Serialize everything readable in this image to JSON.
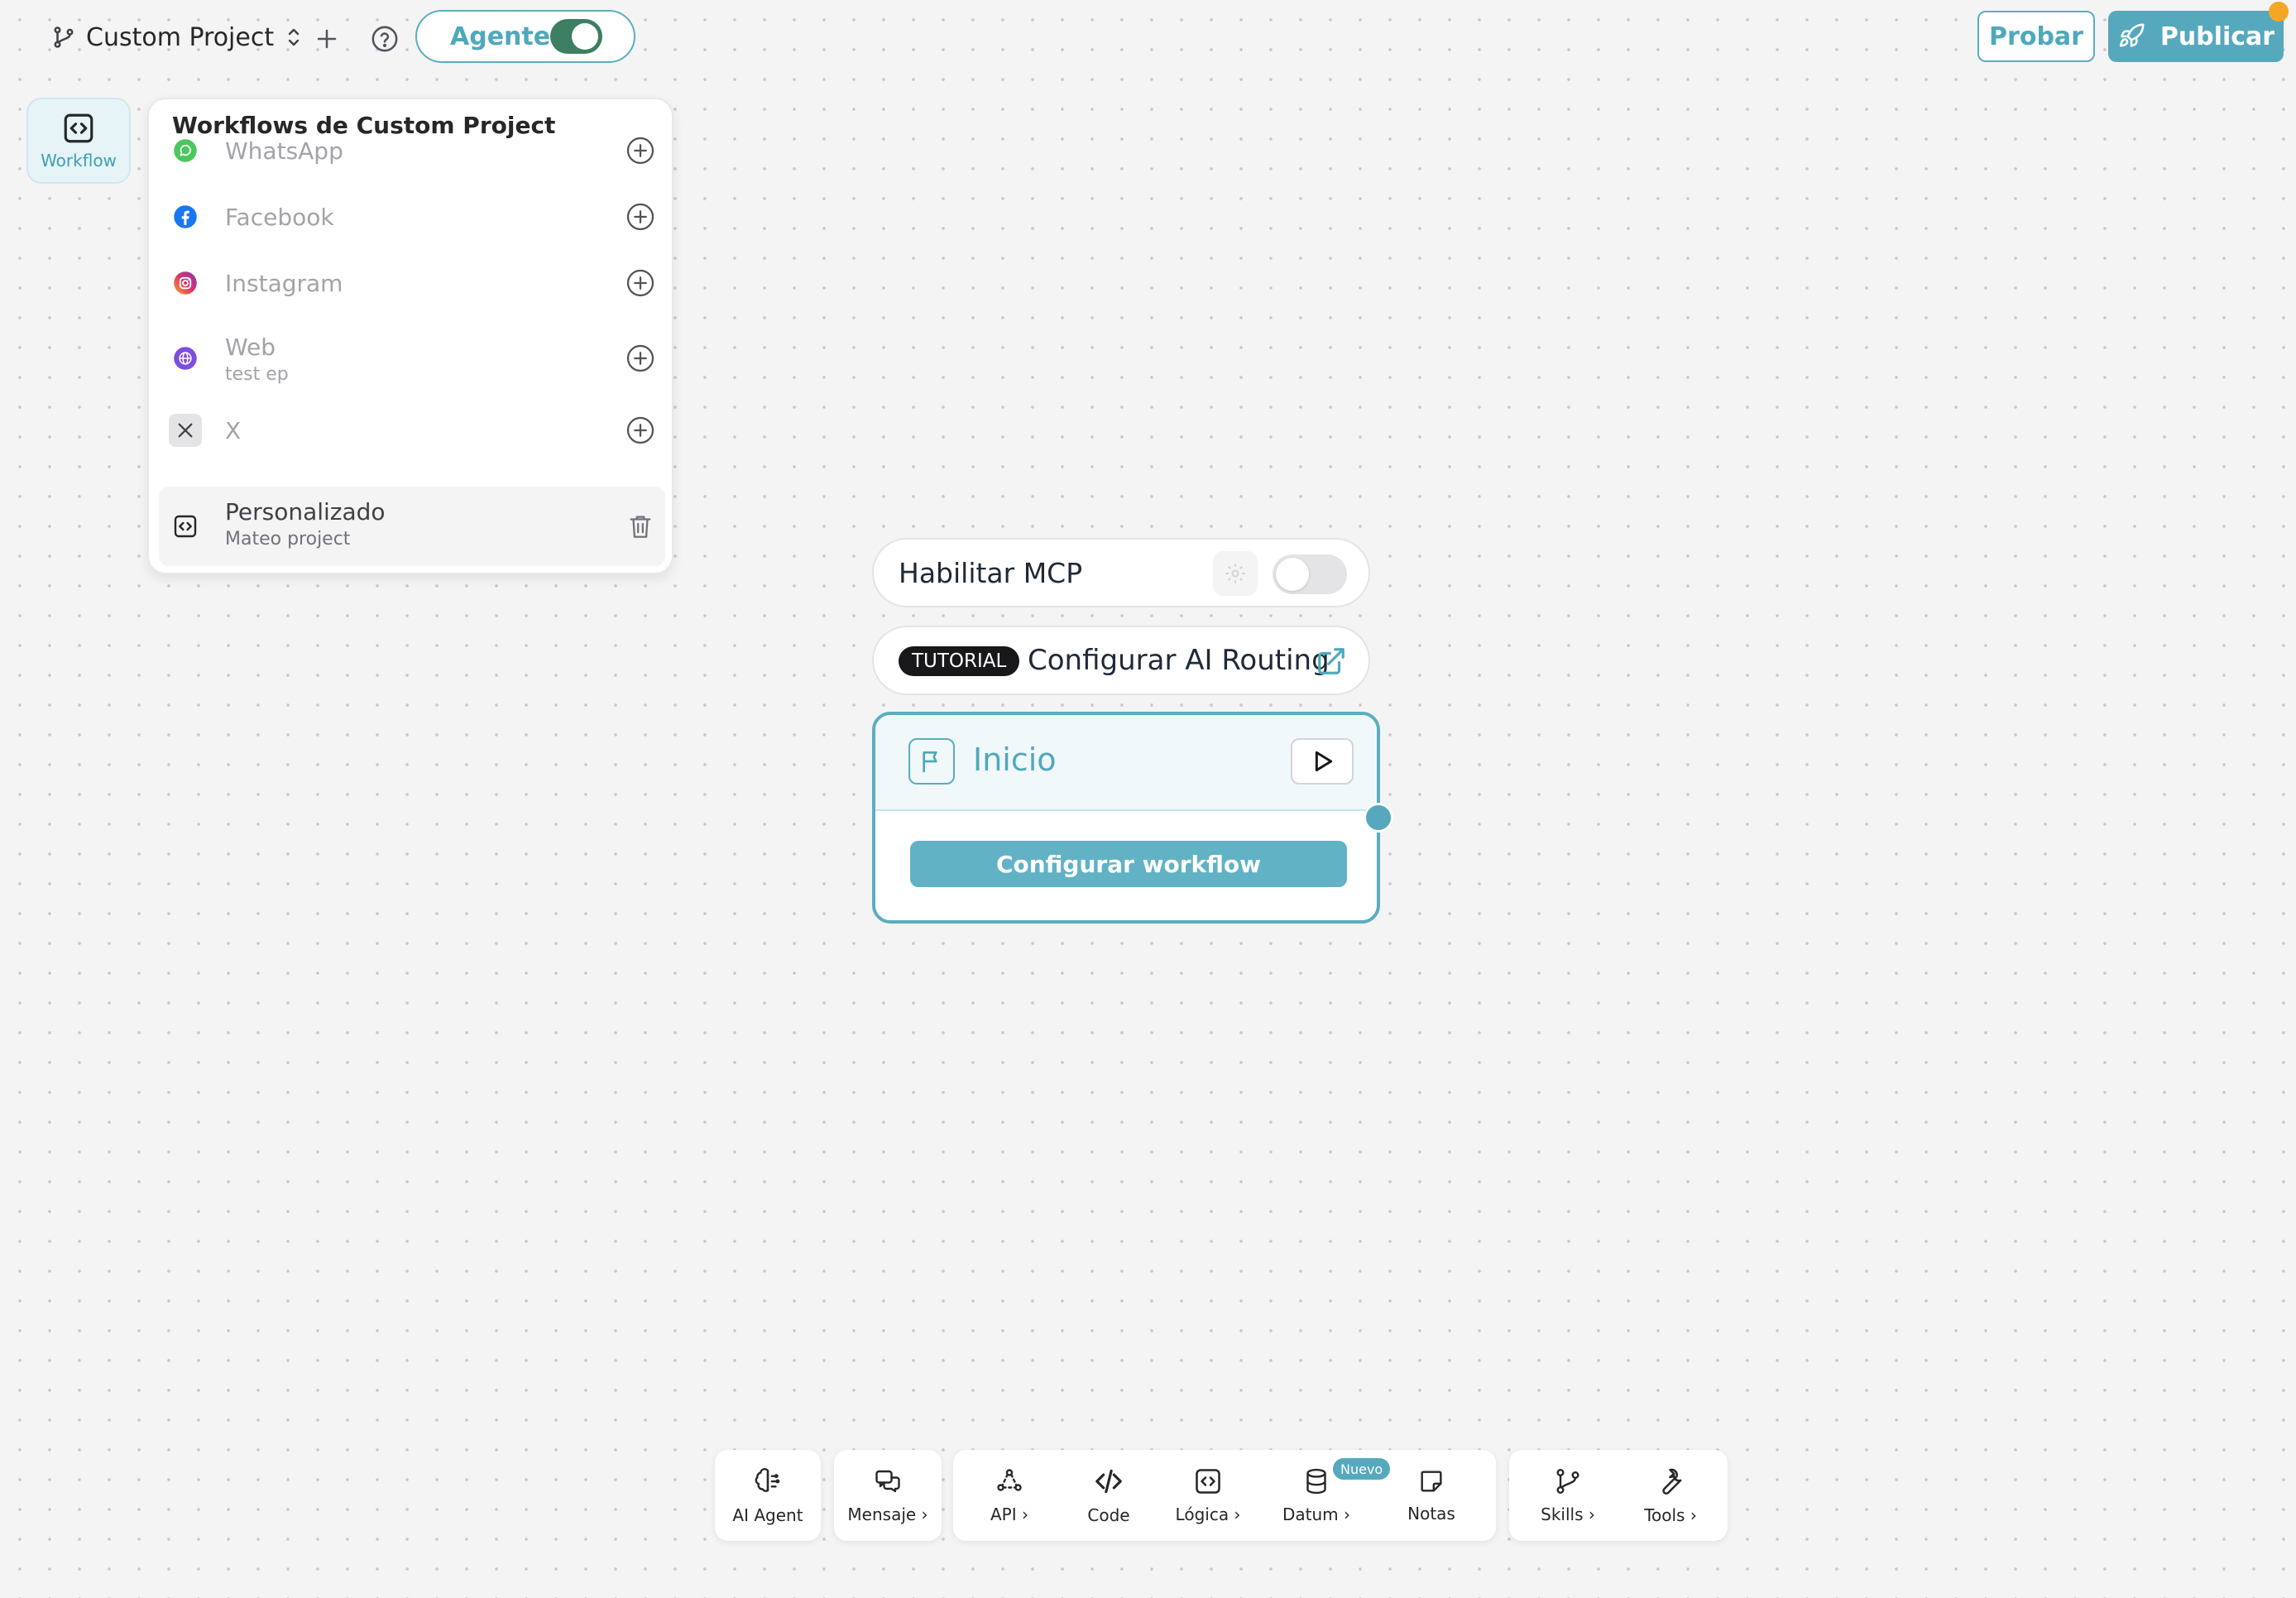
{
  "topbar": {
    "project_name": "Custom Project",
    "agent_label": "Agente",
    "agent_enabled": true,
    "probar_label": "Probar",
    "publicar_label": "Publicar"
  },
  "sidebar": {
    "workflow_label": "Workflow"
  },
  "workflows_panel": {
    "title": "Workflows de Custom Project",
    "items": [
      {
        "name": "WhatsApp",
        "subtitle": "",
        "icon": "whatsapp-icon"
      },
      {
        "name": "Facebook",
        "subtitle": "",
        "icon": "facebook-icon"
      },
      {
        "name": "Instagram",
        "subtitle": "",
        "icon": "instagram-icon"
      },
      {
        "name": "Web",
        "subtitle": "test ep",
        "icon": "web-globe-icon"
      },
      {
        "name": "X",
        "subtitle": "",
        "icon": "x-icon"
      },
      {
        "name": "Personalizado",
        "subtitle": "Mateo project",
        "icon": "code-icon",
        "selected": true
      }
    ]
  },
  "canvas": {
    "mcp_label": "Habilitar MCP",
    "mcp_enabled": false,
    "tutorial_badge": "TUTORIAL",
    "tutorial_label": "Configurar AI Routing",
    "start_node": {
      "title": "Inicio",
      "configure_button": "Configurar workflow"
    }
  },
  "toolbar": {
    "ai_agent": "AI Agent",
    "mensaje": "Mensaje ›",
    "api": "API ›",
    "code": "Code",
    "logica": "Lógica ›",
    "datum": "Datum ›",
    "nuevo_badge": "Nuevo",
    "notas": "Notas",
    "skills": "Skills ›",
    "tools": "Tools ›"
  },
  "colors": {
    "accent": "#56a9bd",
    "toggle_on": "#3c7f62",
    "canvas_bg": "#f4f4f5",
    "notification": "#f5a623"
  }
}
